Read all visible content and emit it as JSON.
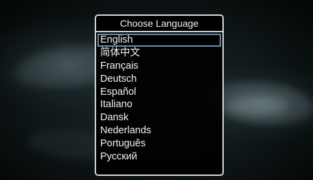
{
  "dialog": {
    "title": "Choose Language"
  },
  "languages": [
    {
      "label": "English",
      "selected": true
    },
    {
      "label": "简体中文",
      "selected": false
    },
    {
      "label": "Français",
      "selected": false
    },
    {
      "label": "Deutsch",
      "selected": false
    },
    {
      "label": "Español",
      "selected": false
    },
    {
      "label": "Italiano",
      "selected": false
    },
    {
      "label": "Dansk",
      "selected": false
    },
    {
      "label": "Nederlands",
      "selected": false
    },
    {
      "label": "Português",
      "selected": false
    },
    {
      "label": "Русский",
      "selected": false
    }
  ],
  "colors": {
    "selection_border": "#6e8fb0",
    "dialog_border": "#d8d8d8",
    "dialog_background": "#000000",
    "text": "#f2f2f2"
  }
}
